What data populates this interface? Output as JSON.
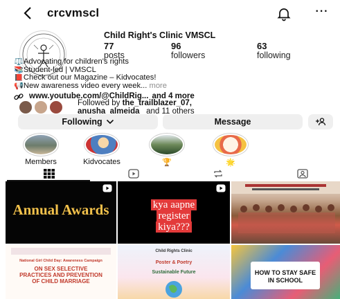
{
  "header": {
    "username": "crcvmscl",
    "icons": [
      "back-chevron-icon",
      "bell-icon",
      "more-dots-icon"
    ],
    "more_label": "···"
  },
  "profile": {
    "display_name": "Child Right's Clinic VMSCL",
    "stats": [
      {
        "value": "77",
        "label": "posts"
      },
      {
        "value": "96",
        "label": "followers"
      },
      {
        "value": "63",
        "label": "following"
      }
    ]
  },
  "bio": {
    "lines": [
      "⚖️Advocating for children's rights",
      "📚Student-led | VMSCL",
      "📕Check out our Magazine – Kidvocates!",
      "📢New awareness video every week..."
    ],
    "more": "more",
    "link": "www.youtube.com/@ChildRig...",
    "and_more": "and 4 more"
  },
  "followed_by": {
    "prefix": "Followed by",
    "users_line1": "the_trailblazer_07,",
    "users_line2": "anusha_almeida_",
    "suffix": "and 11 others"
  },
  "actions": {
    "following_label": "Following",
    "message_label": "Message",
    "add_user_icon": "add-person-icon"
  },
  "highlights": [
    {
      "label": "Members"
    },
    {
      "label": "Kidvocates"
    },
    {
      "label": "🏆"
    },
    {
      "label": "🌟"
    }
  ],
  "tabs": [
    {
      "name": "grid-icon"
    },
    {
      "name": "reels-icon"
    },
    {
      "name": "reposts-icon"
    },
    {
      "name": "tagged-icon"
    }
  ],
  "posts": {
    "annual_awards": "Annual Awards",
    "kya_line1": "kya aapne",
    "kya_line2": "register",
    "kya_line3": "kiya???",
    "safe_school": "HOW TO STAY SAFE IN SCHOOL",
    "campaign_tag": "National Girl Child Day: Awareness Campaign",
    "campaign_title": "ON SEX SELECTIVE PRACTICES AND PREVENTION OF CHILD MARRIAGE",
    "poster_title": "Child Rights Clinic",
    "poster_sub": "Poster & Poetry",
    "poster_theme": "Sustainable Future"
  }
}
